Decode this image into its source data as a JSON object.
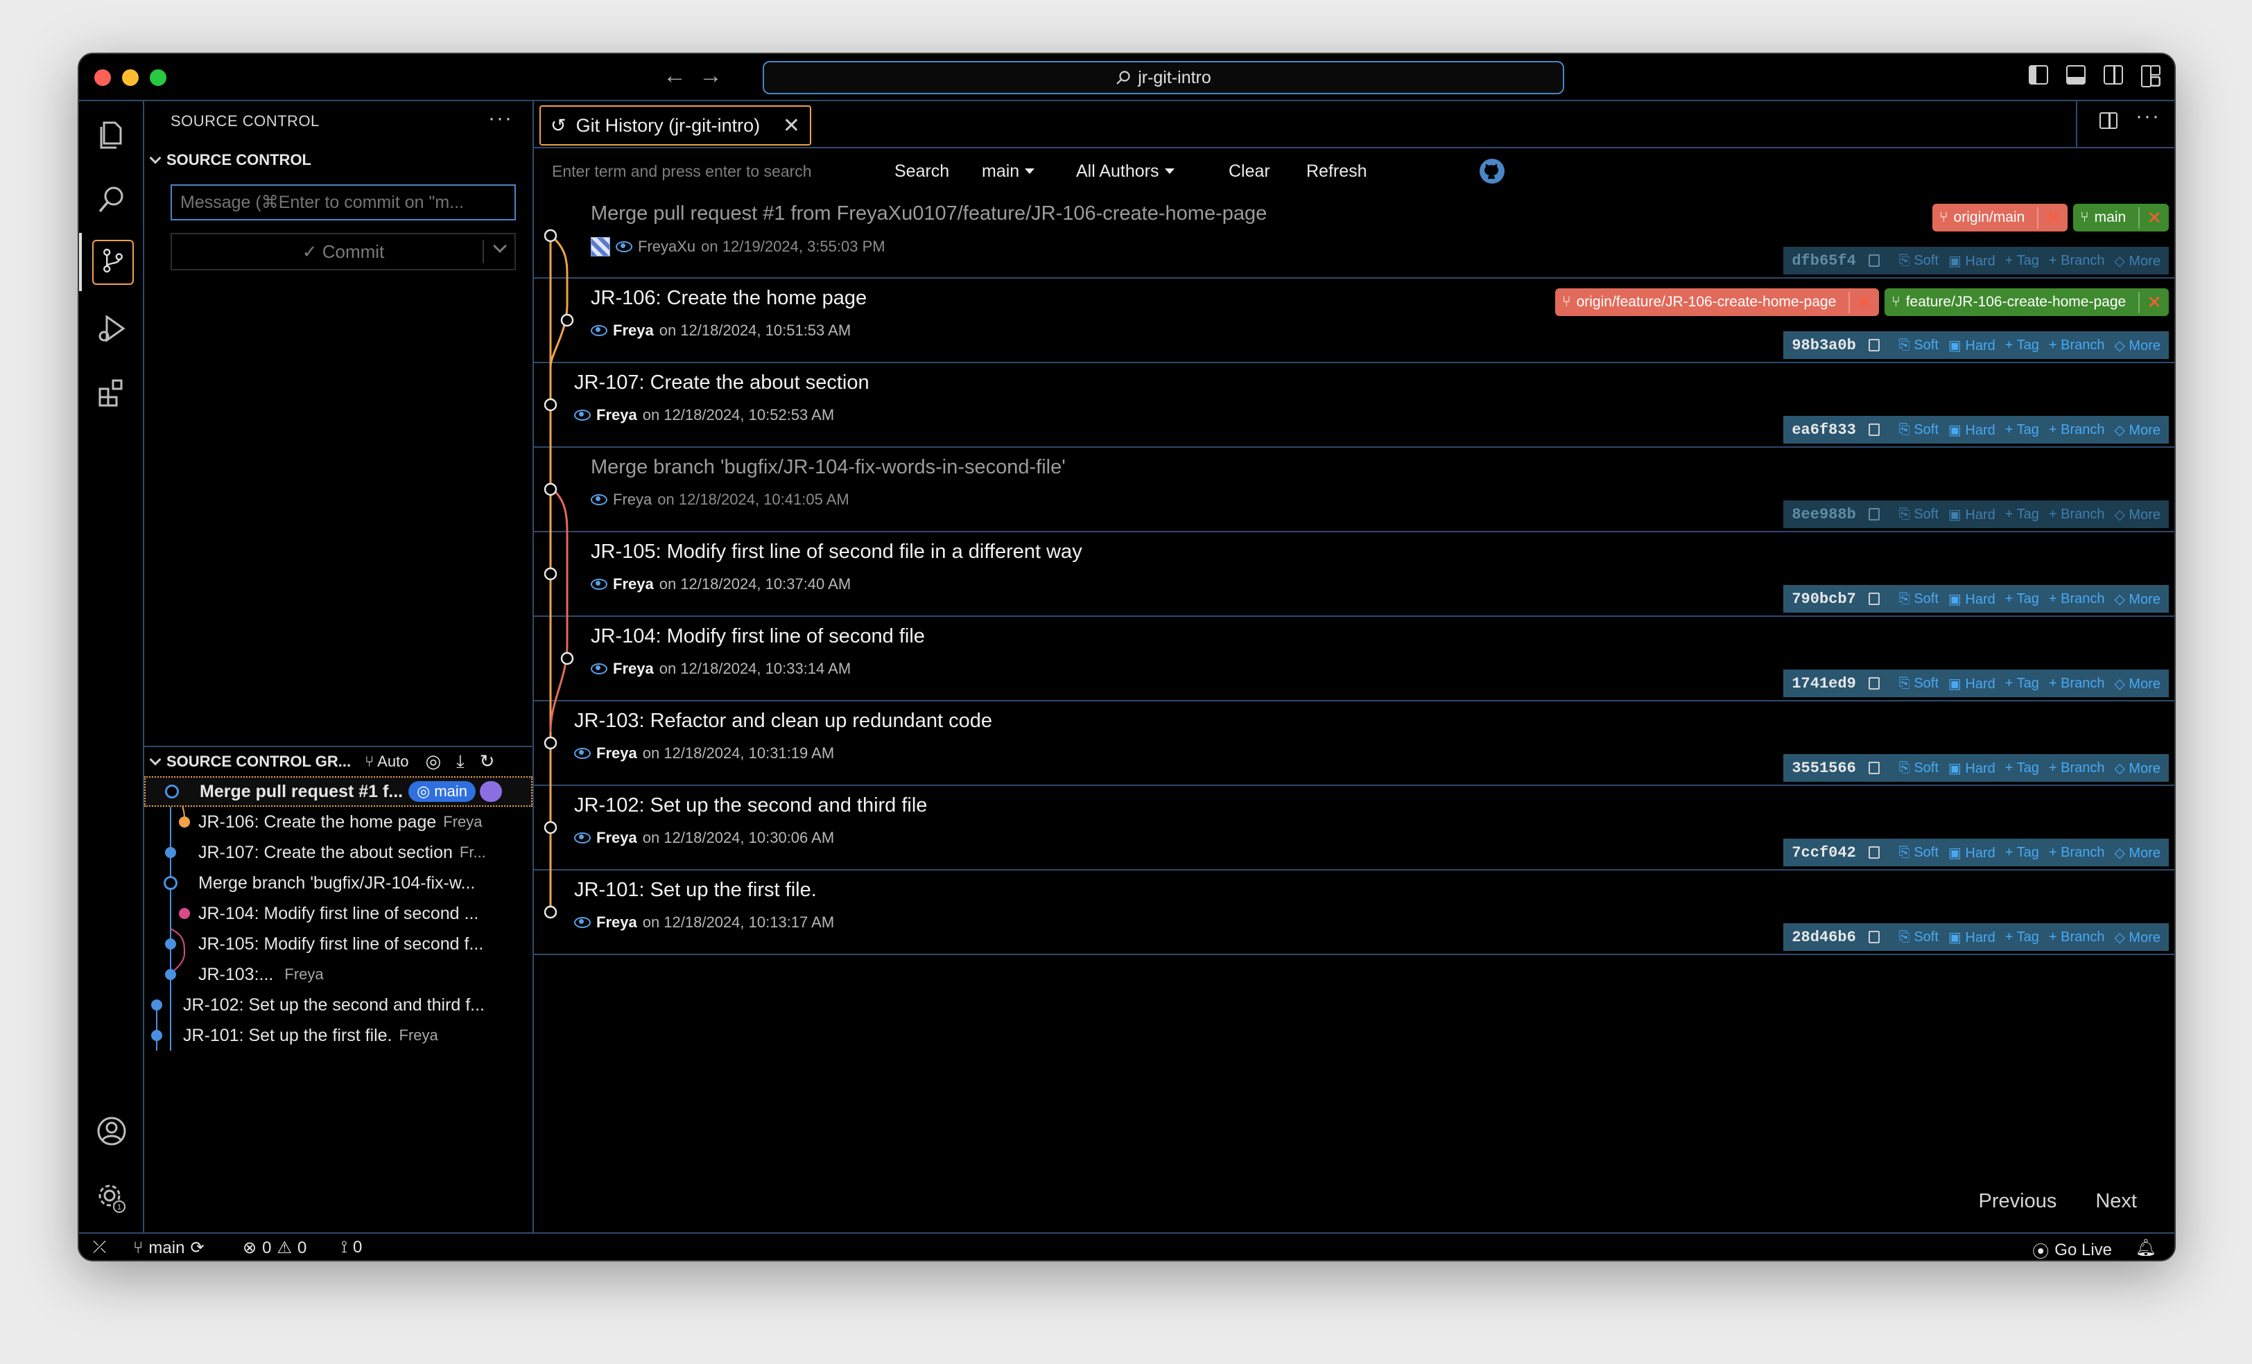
{
  "window": {
    "address": "jr-git-intro"
  },
  "sidebar": {
    "header": "SOURCE CONTROL",
    "section": "SOURCE CONTROL",
    "message_placeholder": "Message (⌘Enter to commit on \"m...",
    "commit_label": "✓ Commit",
    "graph_header": "SOURCE CONTROL GR...",
    "graph_auto": "Auto",
    "graph": [
      {
        "label": "Merge pull request #1 f...",
        "author": "",
        "badge": "main"
      },
      {
        "label": "JR-106: Create the home page",
        "author": "Freya"
      },
      {
        "label": "JR-107: Create the about section",
        "author": "Fr..."
      },
      {
        "label": "Merge branch 'bugfix/JR-104-fix-w...",
        "author": ""
      },
      {
        "label": "JR-104: Modify first line of second ...",
        "author": ""
      },
      {
        "label": "JR-105: Modify first line of second f...",
        "author": ""
      },
      {
        "label": "JR-103:...",
        "author": "Freya"
      },
      {
        "label": "JR-102: Set up the second and third f...",
        "author": ""
      },
      {
        "label": "JR-101: Set up the first file.",
        "author": "Freya"
      }
    ]
  },
  "editor": {
    "tab_title": "Git History (jr-git-intro)",
    "search_placeholder": "Enter term and press enter to search",
    "toolbar": {
      "search": "Search",
      "branch": "main",
      "authors": "All Authors",
      "clear": "Clear",
      "refresh": "Refresh"
    },
    "actions": {
      "soft": "Soft",
      "hard": "Hard",
      "tag": "Tag",
      "branch": "Branch",
      "more": "More"
    },
    "commits": [
      {
        "title": "Merge pull request #1 from FreyaXu0107/feature/JR-106-create-home-page",
        "author": "FreyaXu",
        "date": "on 12/19/2024, 3:55:03 PM",
        "hash": "dfb65f4",
        "dim": true,
        "refs": [
          {
            "kind": "remote",
            "name": "origin/main"
          },
          {
            "kind": "local",
            "name": "main"
          }
        ]
      },
      {
        "title": "JR-106: Create the home page",
        "author": "Freya",
        "date": "on 12/18/2024, 10:51:53 AM",
        "hash": "98b3a0b",
        "refs": [
          {
            "kind": "remote",
            "name": "origin/feature/JR-106-create-home-page"
          },
          {
            "kind": "local",
            "name": "feature/JR-106-create-home-page"
          }
        ]
      },
      {
        "title": "JR-107: Create the about section",
        "author": "Freya",
        "date": "on 12/18/2024, 10:52:53 AM",
        "hash": "ea6f833"
      },
      {
        "title": "Merge branch 'bugfix/JR-104-fix-words-in-second-file'",
        "author": "Freya",
        "date": "on 12/18/2024, 10:41:05 AM",
        "hash": "8ee988b",
        "dim": true
      },
      {
        "title": "JR-105: Modify first line of second file in a different way",
        "author": "Freya",
        "date": "on 12/18/2024, 10:37:40 AM",
        "hash": "790bcb7"
      },
      {
        "title": "JR-104: Modify first line of second file",
        "author": "Freya",
        "date": "on 12/18/2024, 10:33:14 AM",
        "hash": "1741ed9"
      },
      {
        "title": "JR-103: Refactor and clean up redundant code",
        "author": "Freya",
        "date": "on 12/18/2024, 10:31:19 AM",
        "hash": "3551566"
      },
      {
        "title": "JR-102: Set up the second and third file",
        "author": "Freya",
        "date": "on 12/18/2024, 10:30:06 AM",
        "hash": "7ccf042"
      },
      {
        "title": "JR-101: Set up the first file.",
        "author": "Freya",
        "date": "on 12/18/2024, 10:13:17 AM",
        "hash": "28d46b6"
      }
    ],
    "pager": {
      "previous": "Previous",
      "next": "Next"
    }
  },
  "statusbar": {
    "branch": "main",
    "errors": "0",
    "warnings": "0",
    "ports": "0",
    "go_live": "Go Live"
  },
  "colors": {
    "accent": "#4a86c8",
    "graph_orange": "#f0a24a",
    "remote_ref": "#e26a5a",
    "local_ref": "#3f8a2e"
  }
}
